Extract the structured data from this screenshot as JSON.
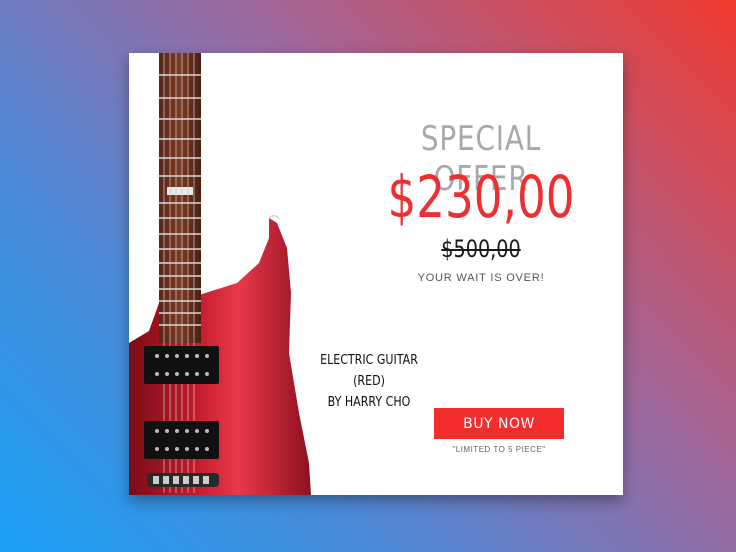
{
  "offer": {
    "heading": "SPECIAL OFFER",
    "price": "$230,00",
    "old_price": "$500,00",
    "tagline": "YOUR WAIT IS OVER!"
  },
  "product": {
    "line1": "ELECTRIC GUITAR (RED)",
    "line2": "BY HARRY CHO"
  },
  "cta": {
    "label": "BUY NOW",
    "note": "\"LIMITED TO 5 PIECE\""
  },
  "colors": {
    "accent": "#f32d2d",
    "price": "#ee2f31",
    "heading": "#a9a9a9"
  },
  "image": {
    "icon": "red-electric-guitar"
  }
}
